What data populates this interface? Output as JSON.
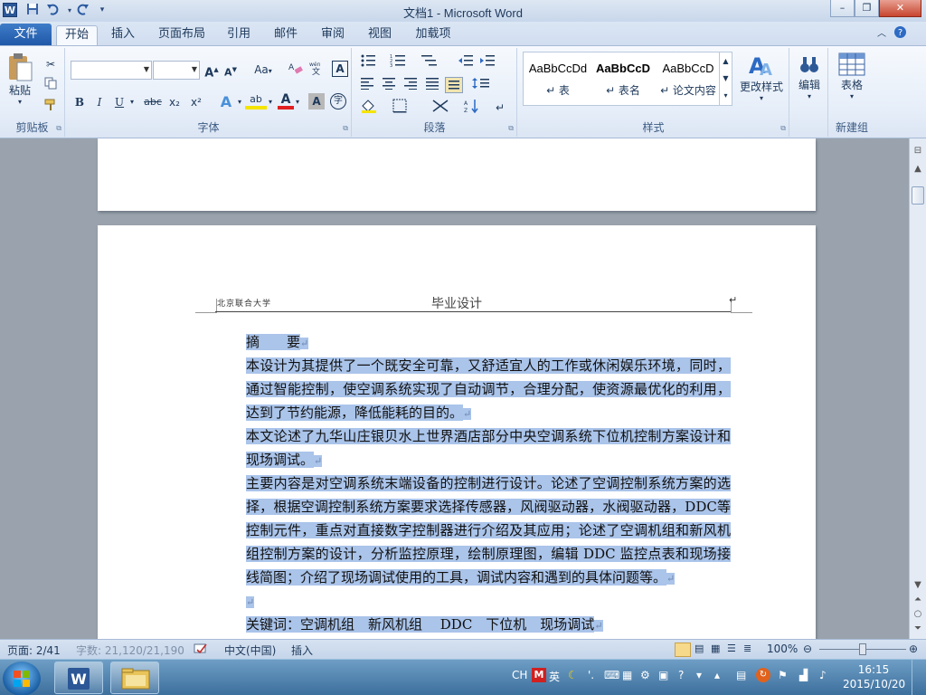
{
  "window": {
    "title": "文档1 - Microsoft Word",
    "app_icon": "W",
    "min_label": "–",
    "max_label": "❐",
    "close_label": "✕"
  },
  "qat": {
    "save_icon": "save-icon",
    "undo_icon": "undo-icon",
    "redo_icon": "redo-icon"
  },
  "tabs": {
    "file": "文件",
    "items": [
      "开始",
      "插入",
      "页面布局",
      "引用",
      "邮件",
      "审阅",
      "视图",
      "加载项"
    ],
    "active": "开始"
  },
  "ribbon": {
    "clipboard": {
      "label": "剪贴板",
      "paste": "粘贴"
    },
    "font": {
      "label": "字体",
      "font_name": "",
      "font_size": "",
      "grow": "A",
      "shrink": "A",
      "case": "Aa",
      "bold": "B",
      "italic": "I",
      "underline": "U",
      "strike": "abc",
      "sub": "x₂",
      "sup": "x²",
      "effects": "A",
      "highlight": "ab",
      "fontcolor": "A",
      "shade": "A",
      "enclose": "字"
    },
    "paragraph": {
      "label": "段落"
    },
    "styles": {
      "label": "样式",
      "items": [
        {
          "sample": "AaBbCcDd",
          "name": "↵ 表"
        },
        {
          "sample": "AaBbCcD",
          "name": "↵ 表名"
        },
        {
          "sample": "AaBbCcD",
          "name": "↵ 论文内容"
        }
      ],
      "change": "更改样式"
    },
    "editing": {
      "label": "编辑"
    },
    "table": {
      "label": "表格",
      "group": "新建组"
    }
  },
  "document": {
    "header_left": "北京联合大学",
    "header_title": "毕业设计",
    "header_mark": "↵",
    "paragraphs": [
      "摘　　要",
      "本设计为其提供了一个既安全可靠，又舒适宜人的工作或休闲娱乐环境，同时，通过智能控制，使空调系统实现了自动调节，合理分配，使资源最优化的利用，达到了节约能源，降低能耗的目的。",
      "本文论述了九华山庄银贝水上世界酒店部分中央空调系统下位机控制方案设计和现场调试。",
      "主要内容是对空调系统末端设备的控制进行设计。论述了空调控制系统方案的选择，根据空调控制系统方案要求选择传感器，风阀驱动器，水阀驱动器，DDC等控制元件，重点对直接数字控制器进行介绍及其应用；论述了空调机组和新风机组控制方案的设计，分析监控原理，绘制原理图，编辑 DDC 监控点表和现场接线简图；介绍了现场调试使用的工具，调试内容和遇到的具体问题等。",
      "",
      "关键词：空调机组　新风机组　 DDC　下位机　现场调试"
    ],
    "para_mark": "↵"
  },
  "statusbar": {
    "page": "页面: 2/41",
    "words": "字数: 21,120/21,190",
    "language": "中文(中国)",
    "mode": "插入",
    "zoom": "100%"
  },
  "taskbar": {
    "tray_lang": "CH",
    "tray_ime": "英",
    "time": "16:15",
    "date": "2015/10/20"
  }
}
